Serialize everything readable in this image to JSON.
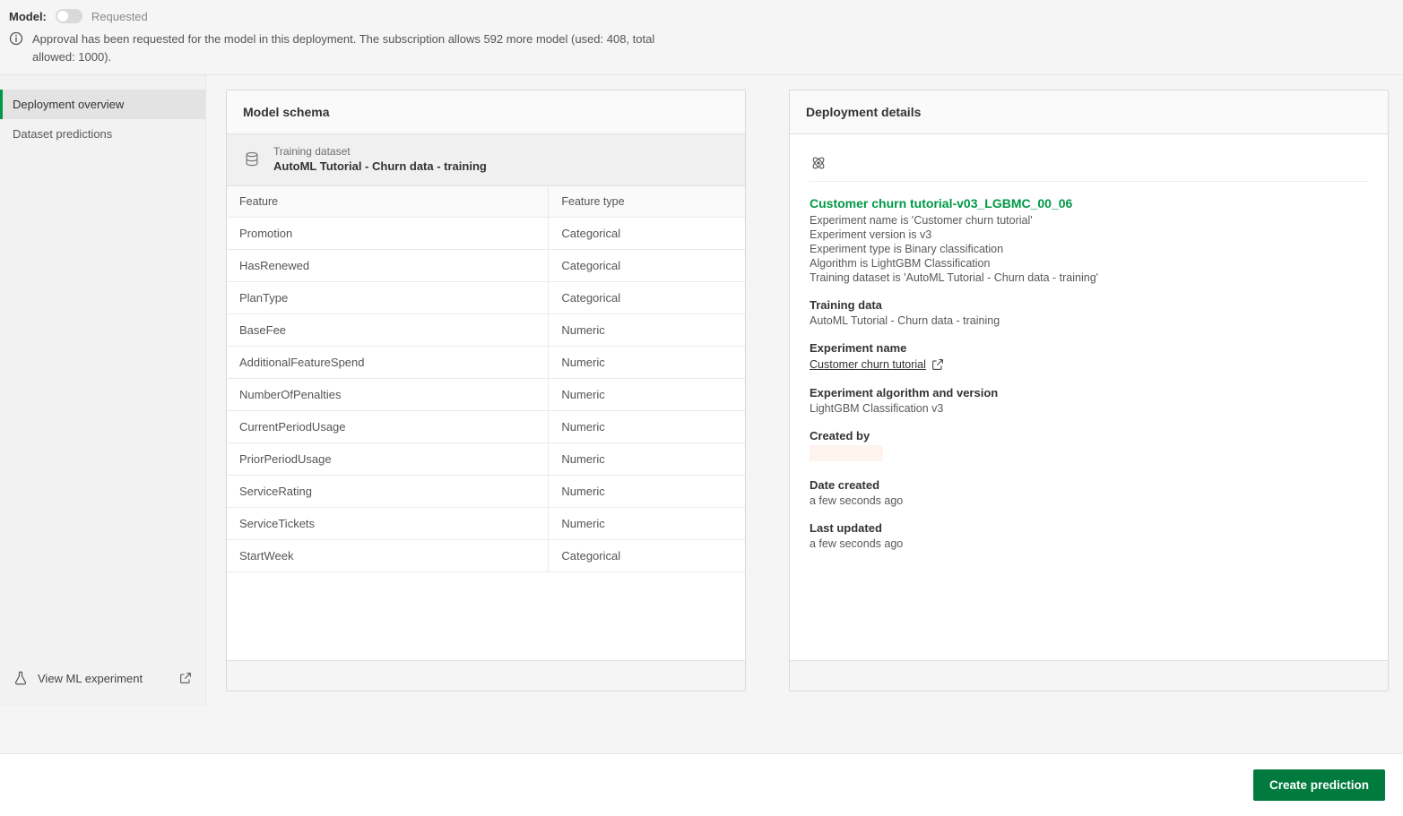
{
  "header": {
    "model_label": "Model:",
    "toggle_status": "Requested",
    "approval_notice": "Approval has been requested for the model in this deployment. The subscription allows 592 more model (used: 408, total allowed: 1000)."
  },
  "sidebar": {
    "items": [
      {
        "label": "Deployment overview",
        "active": true
      },
      {
        "label": "Dataset predictions",
        "active": false
      }
    ],
    "footer_label": "View ML experiment"
  },
  "schema_panel": {
    "title": "Model schema",
    "training_dataset_label": "Training dataset",
    "training_dataset_name": "AutoML Tutorial - Churn data - training",
    "columns": {
      "feature": "Feature",
      "feature_type": "Feature type"
    },
    "rows": [
      {
        "feature": "Promotion",
        "type": "Categorical"
      },
      {
        "feature": "HasRenewed",
        "type": "Categorical"
      },
      {
        "feature": "PlanType",
        "type": "Categorical"
      },
      {
        "feature": "BaseFee",
        "type": "Numeric"
      },
      {
        "feature": "AdditionalFeatureSpend",
        "type": "Numeric"
      },
      {
        "feature": "NumberOfPenalties",
        "type": "Numeric"
      },
      {
        "feature": "CurrentPeriodUsage",
        "type": "Numeric"
      },
      {
        "feature": "PriorPeriodUsage",
        "type": "Numeric"
      },
      {
        "feature": "ServiceRating",
        "type": "Numeric"
      },
      {
        "feature": "ServiceTickets",
        "type": "Numeric"
      },
      {
        "feature": "StartWeek",
        "type": "Categorical"
      }
    ]
  },
  "details_panel": {
    "title": "Deployment details",
    "deployment_name": "Customer churn tutorial-v03_LGBMC_00_06",
    "meta_lines": [
      "Experiment name is 'Customer churn tutorial'",
      "Experiment version is v3",
      "Experiment type is Binary classification",
      "Algorithm is LightGBM Classification",
      "Training dataset is 'AutoML Tutorial - Churn data - training'"
    ],
    "sections": {
      "training_data": {
        "label": "Training data",
        "value": "AutoML Tutorial - Churn data - training"
      },
      "experiment_name": {
        "label": "Experiment name",
        "value": "Customer churn tutorial"
      },
      "algorithm": {
        "label": "Experiment algorithm and version",
        "value": "LightGBM Classification v3"
      },
      "created_by": {
        "label": "Created by"
      },
      "date_created": {
        "label": "Date created",
        "value": "a few seconds ago"
      },
      "last_updated": {
        "label": "Last updated",
        "value": "a few seconds ago"
      }
    }
  },
  "bottom": {
    "create_prediction": "Create prediction"
  }
}
